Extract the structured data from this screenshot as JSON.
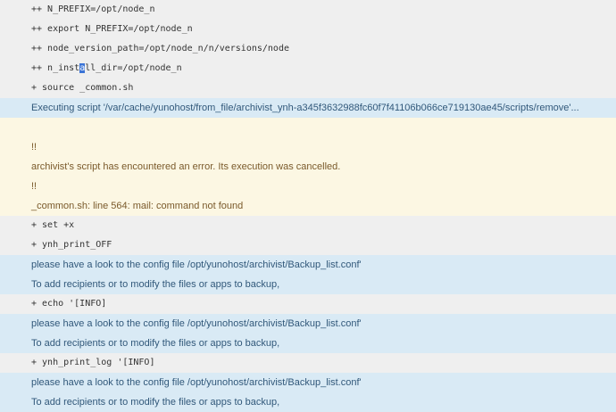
{
  "log_lines": {
    "l1": "++ N_PREFIX=/opt/node_n",
    "l2": "++ export N_PREFIX=/opt/node_n",
    "l3": "++ node_version_path=/opt/node_n/n/versions/node",
    "l4_pre": "++ n_inst",
    "l4_sel": "a",
    "l4_post": "ll_dir=/opt/node_n",
    "l5": "+ source _common.sh",
    "l6": "Executing script '/var/cache/yunohost/from_file/archivist_ynh-a345f3632988fc60f7f41106b066ce719130ae45/scripts/remove'...",
    "l7": "!!",
    "l8": "archivist's script has encountered an error. Its execution was cancelled.",
    "l9": "!!",
    "l10": "_common.sh: line 564: mail: command not found",
    "l11": "+ set +x",
    "l12": "+ ynh_print_OFF",
    "l13": "please have a look to the config file /opt/yunohost/archivist/Backup_list.conf'",
    "l14": "To add recipients or to modify the files or apps to backup,",
    "l15": "+ echo '[INFO]",
    "l16": "please have a look to the config file /opt/yunohost/archivist/Backup_list.conf'",
    "l17": "To add recipients or to modify the files or apps to backup,",
    "l18": "+ ynh_print_log '[INFO]",
    "l19": "please have a look to the config file /opt/yunohost/archivist/Backup_list.conf'",
    "l20": "To add recipients or to modify the files or apps to backup,"
  },
  "colors": {
    "page_bg": "#efefef",
    "info_bg": "#d9eaf5",
    "info_text": "#31587a",
    "warn_bg": "#fcf7e3",
    "warn_text": "#7a5a2b",
    "selection": "#3b74d6"
  }
}
